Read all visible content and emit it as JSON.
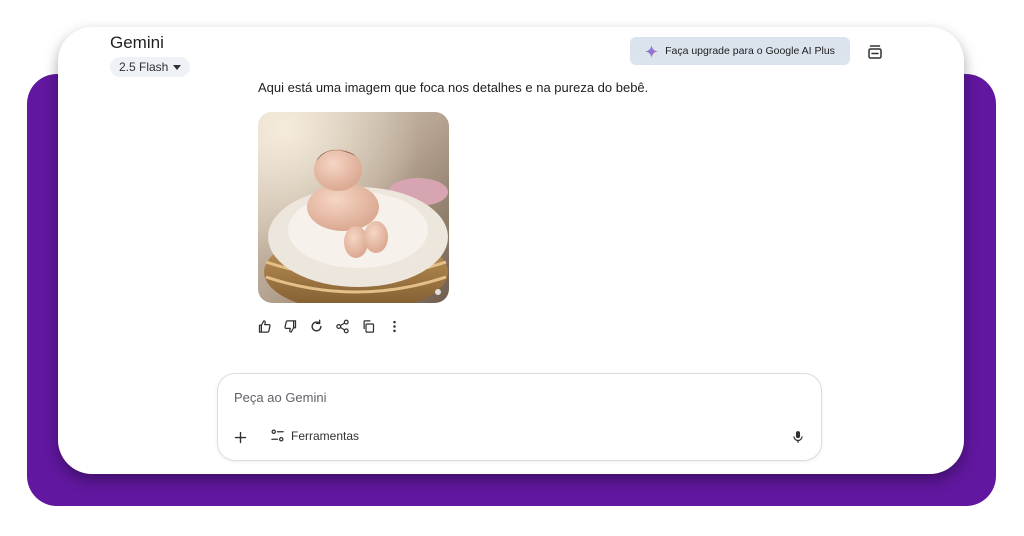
{
  "header": {
    "app_title": "Gemini",
    "model_label": "2.5 Flash",
    "upgrade_label": "Faça upgrade para o Google AI Plus",
    "temp_chat_icon": "temporary-chat-icon",
    "sparkle_icon": "gemini-sparkle-icon"
  },
  "conversation": {
    "response_text": "Aqui está uma imagem que foca nos detalhes e na pureza do bebê.",
    "image_subject": "newborn-baby-in-basket"
  },
  "actions": {
    "icons": [
      "thumbs-up-icon",
      "thumbs-down-icon",
      "regenerate-icon",
      "share-icon",
      "copy-icon",
      "more-options-icon"
    ]
  },
  "composer": {
    "placeholder": "Peça ao Gemini",
    "tools_label": "Ferramentas",
    "add_icon": "plus-icon",
    "tools_icon": "tools-icon",
    "mic_icon": "microphone-icon"
  },
  "colors": {
    "backdrop": "#61179f",
    "upgrade_button": "#dbe3ec",
    "model_chip": "#eef2f7",
    "text": "#1f1f1f"
  }
}
